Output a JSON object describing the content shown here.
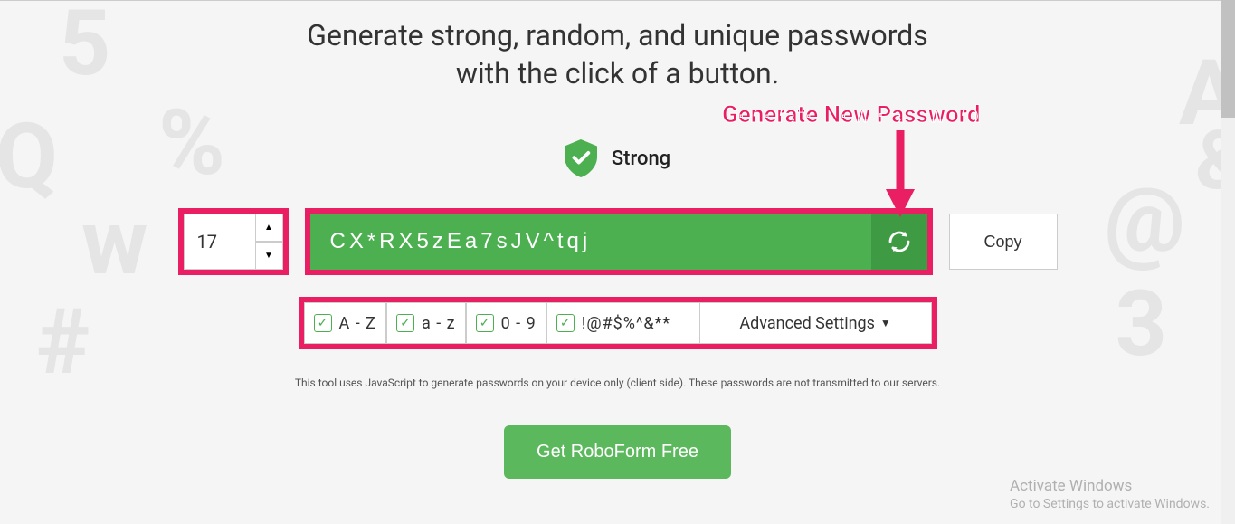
{
  "heading": {
    "line1": "Generate strong, random, and unique passwords",
    "line2": "with the click of a button."
  },
  "strength": {
    "label": "Strong"
  },
  "length": {
    "value": "17"
  },
  "password": {
    "value": "CX*RX5zEa7sJV^tqj"
  },
  "copy": {
    "label": "Copy"
  },
  "options": {
    "upper_label": "A - Z",
    "lower_label": "a - z",
    "digits_label": "0 - 9",
    "symbols_value": "!@#$%^&**",
    "advanced_label": "Advanced Settings"
  },
  "disclaimer": "This tool uses JavaScript to generate passwords on your device only (client side). These passwords are not transmitted to our servers.",
  "cta": {
    "label": "Get RoboForm Free"
  },
  "annotation": {
    "label": "Generate New Password"
  },
  "watermark": {
    "title": "Activate Windows",
    "sub": "Go to Settings to activate Windows."
  }
}
